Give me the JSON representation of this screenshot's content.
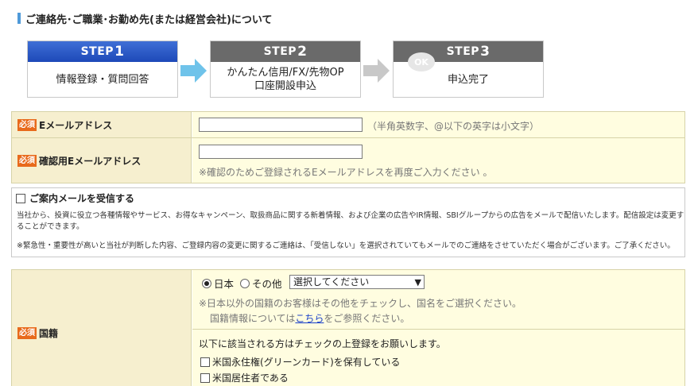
{
  "section_title": "ご連絡先･ご職業･お勤め先(または経営会社)について",
  "steps": [
    {
      "label": "STEP",
      "num": "1",
      "text_line1": "情報登録・質問回答",
      "text_line2": ""
    },
    {
      "label": "STEP",
      "num": "2",
      "text_line1": "かんたん信用/FX/先物OP",
      "text_line2": "口座開設申込"
    },
    {
      "label": "STEP",
      "num": "3",
      "text_line1": "申込完了",
      "text_line2": "",
      "badge": "OK"
    }
  ],
  "colors": {
    "active_step": "#1d49b8",
    "inactive_step": "#6a6a6a",
    "required": "#e86a1c",
    "label_bg": "#f6efcf",
    "value_bg": "#fffde0",
    "link": "#1a40c8"
  },
  "required_badge": "必須",
  "email": {
    "label": "Eメールアドレス",
    "value": "",
    "note": "（半角英数字、@以下の英字は小文字）"
  },
  "email_confirm": {
    "label": "確認用Eメールアドレス",
    "value": "",
    "note": "※確認のためご登録されるEメールアドレスを再度ご入力ください 。"
  },
  "mail_opt_in": {
    "label": "ご案内メールを受信する",
    "checked": false,
    "desc1": "当社から、投資に役立つ各種情報やサービス、お得なキャンペーン、取扱商品に関する新着情報、および企業の広告やIR情報、SBIグループからの広告をメールで配信いたします。配信設定は変更す",
    "desc2": "ることができます。",
    "desc3": "※緊急性・重要性が高いと当社が判断した内容、ご登録内容の変更に関するご連絡は、「受信しない」を選択されていてもメールでのご連絡をさせていただく場合がございます。ご了承ください。"
  },
  "nationality": {
    "label": "国籍",
    "option_japan": "日本",
    "option_other": "その他",
    "selected": "日本",
    "select_placeholder": "選択してください",
    "note1": "※日本以外の国籍のお客様はその他をチェックし、国名をご選択ください。",
    "note2_before": "国籍情報については",
    "note2_link": "こちら",
    "note2_after": "をご参照ください。",
    "check_intro": "以下に該当される方はチェックの上登録をお願いします。",
    "check_green_card": "米国永住権(グリーンカード)を保有している",
    "check_us_resident": "米国居住者である"
  }
}
